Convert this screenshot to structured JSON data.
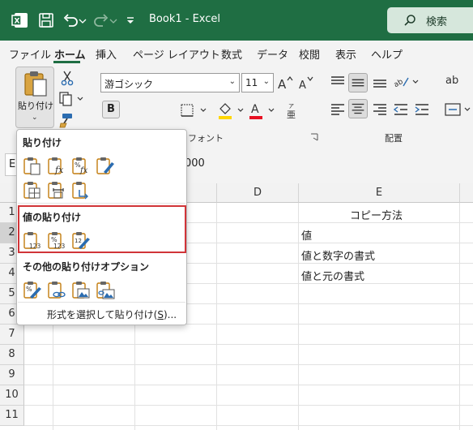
{
  "app": {
    "title": "Book1  -  Excel",
    "search_label": "検索"
  },
  "menu": {
    "tabs": [
      "ファイル",
      "ホーム",
      "挿入",
      "ページ レイアウト",
      "数式",
      "データ",
      "校閲",
      "表示",
      "ヘルプ"
    ],
    "active": "ホーム"
  },
  "ribbon": {
    "paste_label": "貼り付け",
    "font_name": "游ゴシック",
    "font_size": "11",
    "font_group_label": "フォント",
    "alignment_group_label": "配置",
    "bold_label": "B",
    "wrap_label": "ab"
  },
  "formula_bar": {
    "name_box": "E",
    "content": "000"
  },
  "grid": {
    "columns": [
      "D",
      "E"
    ],
    "rows": [
      "1",
      "2",
      "3",
      "4",
      "5",
      "6",
      "7",
      "8",
      "9",
      "10",
      "11"
    ],
    "selected_row": "2",
    "cells": {
      "E1": "コピー方法",
      "E2": "値",
      "E3": "値と数字の書式",
      "E4": "値と元の書式"
    }
  },
  "paste_menu": {
    "section1": "貼り付け",
    "section2": "値の貼り付け",
    "section3": "その他の貼り付けオプション",
    "special_prefix": "形式を選択して貼り付け(",
    "special_key": "S",
    "special_suffix": ")..."
  },
  "colors": {
    "title_bar": "#1f6e43",
    "highlight_border": "#d13438",
    "icon_orange": "#c27c0e",
    "icon_blue": "#2b6cb0"
  }
}
